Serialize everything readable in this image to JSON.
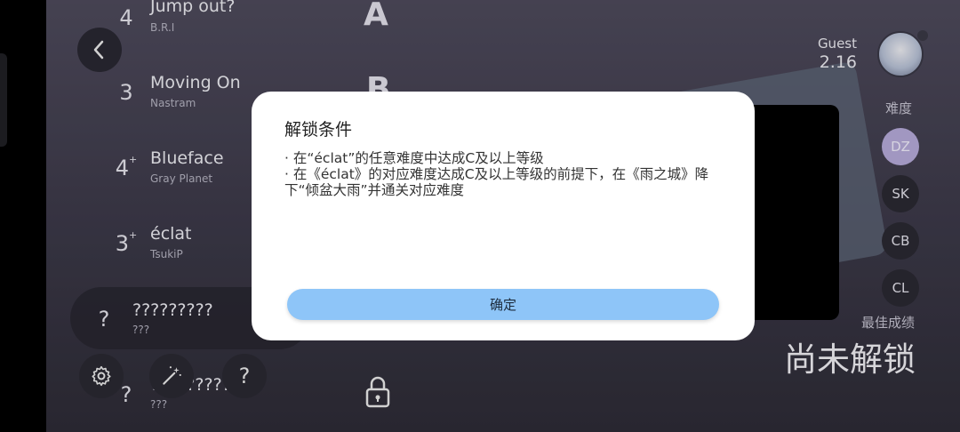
{
  "songs": [
    {
      "level": "4",
      "plus": "",
      "title": "Jump out?",
      "artist": "B.R.I"
    },
    {
      "level": "3",
      "plus": "",
      "title": "Moving On",
      "artist": "Nastram"
    },
    {
      "level": "4",
      "plus": "+",
      "title": "Blueface",
      "artist": "Gray Planet"
    },
    {
      "level": "3",
      "plus": "+",
      "title": "éclat",
      "artist": "TsukiP"
    },
    {
      "level": "?",
      "plus": "",
      "title": "?????????",
      "artist": "???"
    },
    {
      "level": "?",
      "plus": "",
      "title": "?????????",
      "artist": "???"
    }
  ],
  "grades": [
    "A",
    "B"
  ],
  "player": {
    "name": "Guest",
    "rating": "2.16"
  },
  "difficulty": {
    "label": "难度",
    "options": [
      {
        "label": "DZ",
        "active": true
      },
      {
        "label": "SK",
        "active": false
      },
      {
        "label": "CB",
        "active": false
      },
      {
        "label": "CL",
        "active": false
      }
    ]
  },
  "best_score": {
    "label": "最佳成绩",
    "value": "尚未解锁"
  },
  "bottom_buttons": {
    "settings_icon": "gear-icon",
    "magic_icon": "magic-wand-icon",
    "help_label": "?"
  },
  "dialog": {
    "title": "解锁条件",
    "line1": "· 在“éclat”的任意难度中达成C及以上等级",
    "line2": "· 在《éclat》的对应难度达成C及以上等级的前提下，在《雨之城》降下“倾盆大雨”并通关对应难度",
    "confirm_label": "确定"
  },
  "colors": {
    "confirm_button": "#8ec5f8",
    "active_difficulty": "#b8acdc"
  }
}
